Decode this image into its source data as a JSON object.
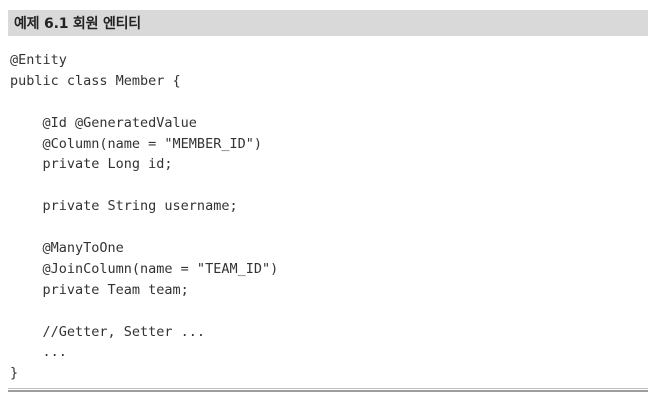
{
  "example": {
    "caption": "예제 6.1 회원 엔티티",
    "code_lines": [
      "@Entity",
      "public class Member {",
      "",
      "    @Id @GeneratedValue",
      "    @Column(name = \"MEMBER_ID\")",
      "    private Long id;",
      "",
      "    private String username;",
      "",
      "    @ManyToOne",
      "    @JoinColumn(name = \"TEAM_ID\")",
      "    private Team team;",
      "",
      "    //Getter, Setter ...",
      "    ...",
      "}"
    ]
  }
}
